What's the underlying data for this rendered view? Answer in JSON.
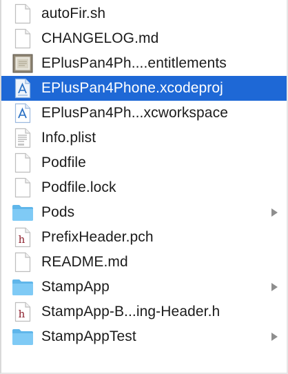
{
  "files": [
    {
      "name": "autoFir.sh",
      "icon": "document-icon",
      "selected": false,
      "expandable": false
    },
    {
      "name": "CHANGELOG.md",
      "icon": "document-icon",
      "selected": false,
      "expandable": false
    },
    {
      "name": "EPlusPan4Ph....entitlements",
      "icon": "entitlements-icon",
      "selected": false,
      "expandable": false
    },
    {
      "name": "EPlusPan4Phone.xcodeproj",
      "icon": "xcodeproj-icon",
      "selected": true,
      "expandable": false
    },
    {
      "name": "EPlusPan4Ph...xcworkspace",
      "icon": "xcworkspace-icon",
      "selected": false,
      "expandable": false
    },
    {
      "name": "Info.plist",
      "icon": "plist-icon",
      "selected": false,
      "expandable": false
    },
    {
      "name": "Podfile",
      "icon": "document-icon",
      "selected": false,
      "expandable": false
    },
    {
      "name": "Podfile.lock",
      "icon": "document-icon",
      "selected": false,
      "expandable": false
    },
    {
      "name": "Pods",
      "icon": "folder-icon",
      "selected": false,
      "expandable": true
    },
    {
      "name": "PrefixHeader.pch",
      "icon": "header-file-icon",
      "selected": false,
      "expandable": false
    },
    {
      "name": "README.md",
      "icon": "document-icon",
      "selected": false,
      "expandable": false
    },
    {
      "name": "StampApp",
      "icon": "folder-icon",
      "selected": false,
      "expandable": true
    },
    {
      "name": "StampApp-B...ing-Header.h",
      "icon": "header-file-icon",
      "selected": false,
      "expandable": false
    },
    {
      "name": "StampAppTest",
      "icon": "folder-icon",
      "selected": false,
      "expandable": true
    }
  ],
  "colors": {
    "selection": "#1e68d6",
    "folder": "#6cc3f2",
    "text": "#1b1b1b"
  }
}
